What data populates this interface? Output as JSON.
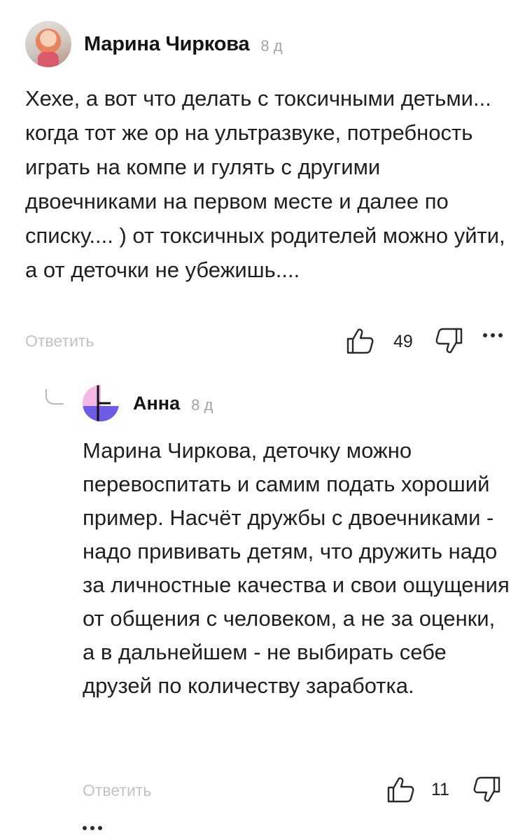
{
  "comment": {
    "author": "Марина Чиркова",
    "time": "8 д",
    "text": "Хехе, а вот что делать с токсичными детьми... когда тот же ор на ультразвуке, потребность играть на компе и гулять с другими двоечниками на первом месте и далее по списку.... ) от токсичных родителей можно уйти, а от деточки не убежишь....",
    "reply_label": "Ответить",
    "likes": "49",
    "icons": {
      "like": "thumbs-up-icon",
      "dislike": "thumbs-down-icon",
      "more": "more-dots-icon",
      "avatar": "avatar"
    }
  },
  "reply": {
    "author": "Анна",
    "time": "8 д",
    "text": "Марина Чиркова, деточку можно перевоспитать и самим подать хороший пример. Насчёт дружбы с двоечниками - надо прививать детям, что дружить надо за личностные качества и свои ощущения от общения с человеком, а не за оценки, а в дальнейшем - не выбирать себе друзей по количеству заработка.",
    "reply_label": "Ответить",
    "likes": "11",
    "icons": {
      "like": "thumbs-up-icon",
      "dislike": "thumbs-down-icon",
      "more": "more-dots-icon",
      "thread": "reply-thread-icon"
    }
  },
  "colors": {
    "text": "#1f1f1f",
    "muted": "#a3a3a3",
    "reply_link": "#c2c2c2",
    "anna_pink": "#f4b8e4",
    "anna_purple": "#6d5ce6"
  }
}
